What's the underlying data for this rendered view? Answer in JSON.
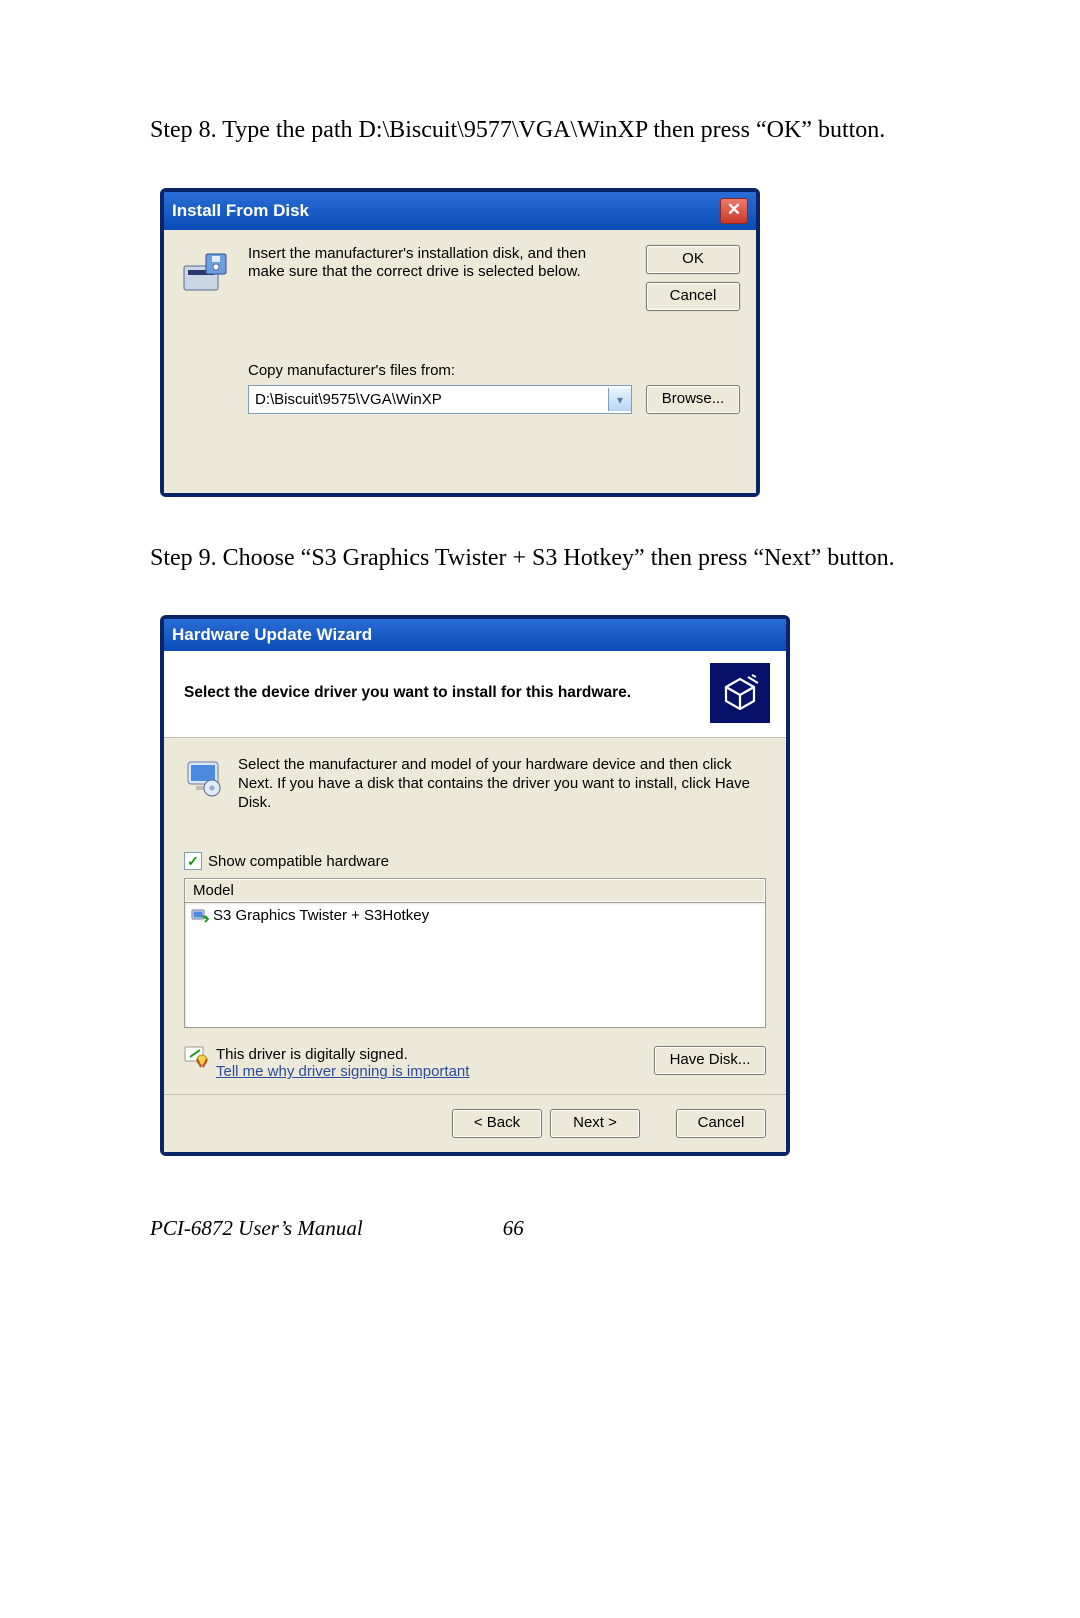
{
  "step8": "Step 8.  Type the path D:\\Biscuit\\9577\\VGA\\WinXP  then press “OK” button.",
  "step9": "Step 9.  Choose “S3 Graphics Twister + S3 Hotkey” then press “Next” button.",
  "dlg1": {
    "title": "Install From Disk",
    "close": "✕",
    "message": "Insert the manufacturer's installation disk, and then make sure that the correct drive is selected below.",
    "ok": "OK",
    "cancel": "Cancel",
    "copy_label": "Copy manufacturer's files from:",
    "path_value": "D:\\Biscuit\\9575\\VGA\\WinXP",
    "browse": "Browse..."
  },
  "dlg2": {
    "title": "Hardware Update Wizard",
    "band_title": "Select the device driver you want to install for this hardware.",
    "info": "Select the manufacturer and model of your hardware device and then click Next. If you have a disk that contains the driver you want to install, click Have Disk.",
    "show_compatible": "Show compatible hardware",
    "model_header": "Model",
    "model_item": "S3 Graphics Twister + S3Hotkey",
    "signed_text": "This driver is digitally signed.",
    "signed_link": "Tell me why driver signing is important",
    "have_disk": "Have Disk...",
    "back": "< Back",
    "next": "Next >",
    "cancel": "Cancel"
  },
  "footer": {
    "manual": "PCI-6872 User’s Manual",
    "page": "66"
  }
}
